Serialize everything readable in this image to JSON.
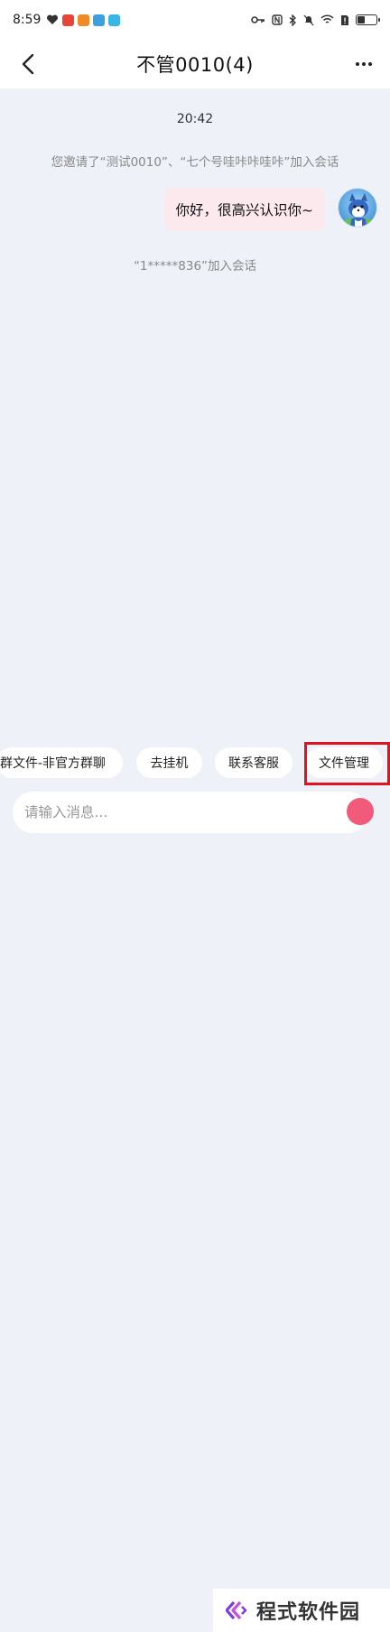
{
  "status_bar": {
    "time": "8:59",
    "app_icon_colors": [
      "#e8443a",
      "#f08a24",
      "#3aa0e0",
      "#39b6e8"
    ],
    "right_icons": [
      "key-icon",
      "nfc-icon",
      "bluetooth-icon",
      "mute-icon",
      "wifi-icon",
      "sim-alert-icon",
      "battery-icon"
    ],
    "battery_level": 0.35
  },
  "header": {
    "title": "不管0010(4)"
  },
  "chat": {
    "timestamp": "20:42",
    "system_messages": [
      "您邀请了“测试0010”、“七个号哇咔咔哇咔”加入会话",
      "“1*****836”加入会话"
    ],
    "messages": [
      {
        "text": "你好，很高兴认识你~",
        "from": "self"
      }
    ]
  },
  "quick_actions": [
    "群文件-非官方群聊",
    "去挂机",
    "联系客服",
    "文件管理"
  ],
  "input": {
    "placeholder": "请输入消息..."
  },
  "watermark": {
    "text": "程式软件园"
  },
  "colors": {
    "bubble": "#fce9ee",
    "highlight": "#e0141e",
    "background": "#eef1f7",
    "accent": "#f15a7a"
  }
}
